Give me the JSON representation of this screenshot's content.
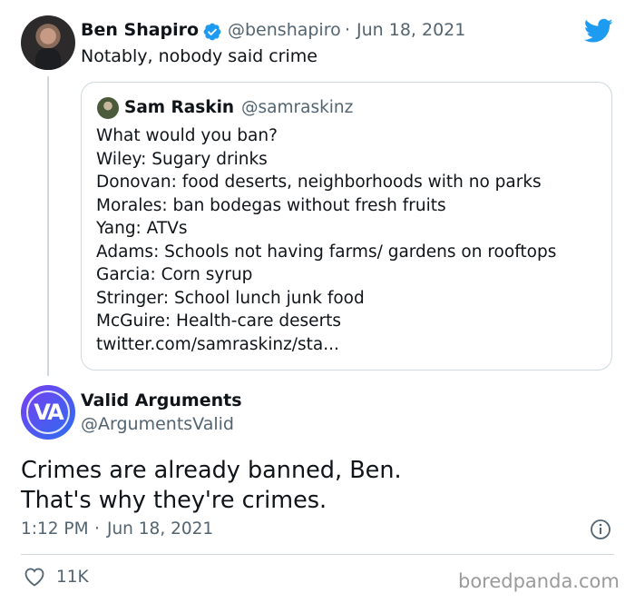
{
  "tweet": {
    "author_name": "Ben Shapiro",
    "author_handle": "@benshapiro",
    "separator": "·",
    "date": "Jun 18, 2021",
    "text": "Notably, nobody said crime",
    "avatar_icon": "profile-photo",
    "verified_icon": "verified-badge-icon",
    "brand_icon": "twitter-bird-icon",
    "brand_color": "#1d9bf0"
  },
  "quoted_tweet": {
    "author_name": "Sam Raskin",
    "author_handle": "@samraskinz",
    "lines": [
      "What would you ban?",
      "Wiley: Sugary drinks",
      "Donovan: food deserts, neighborhoods with no parks",
      "Morales: ban bodegas without fresh fruits",
      "Yang: ATVs",
      "Adams: Schools not having farms/ gardens on rooftops",
      "Garcia: Corn syrup",
      "Stringer: School lunch junk food",
      "McGuire: Health-care deserts",
      "twitter.com/samraskinz/sta..."
    ]
  },
  "reply": {
    "author_name": "Valid Arguments",
    "author_handle": "@ArgumentsValid",
    "logo_text": "VA",
    "text_line1": "Crimes are already banned, Ben.",
    "text_line2": "That's why they're crimes.",
    "time": "1:12 PM",
    "separator": "·",
    "date": "Jun 18, 2021",
    "likes": "11K"
  },
  "watermark": "boredpanda.com"
}
